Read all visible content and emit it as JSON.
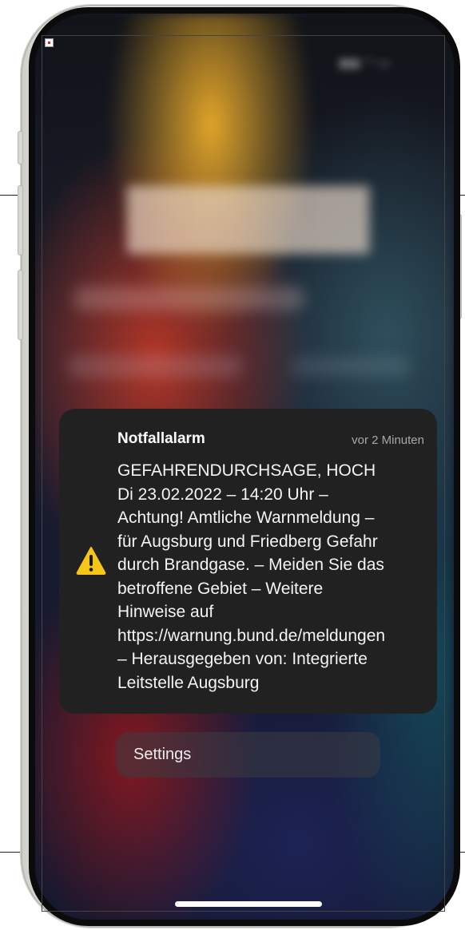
{
  "notification": {
    "app_name": "Notfallalarm",
    "time": "vor 2 Minuten",
    "icon": "warning-triangle-icon",
    "icon_color": "#F5C518",
    "lines": [
      "GEFAHRENDURCHSAGE, HOCH",
      "Di 23.02.2022 – 14:20 Uhr –",
      "Achtung! Amtliche Warnmeldung –",
      "für Augsburg und Friedberg Gefahr",
      "durch Brandgase. – Meiden Sie das",
      "betroffene Gebiet – Weitere",
      "Hinweise auf",
      "https://warnung.bund.de/meldungen",
      "– Herausgegeben von: Integrierte",
      "Leitstelle Augsburg"
    ]
  },
  "settings_button": {
    "label": "Settings"
  },
  "colors": {
    "notification_background": "#212121",
    "phone_frame": "#E6E6E2"
  }
}
